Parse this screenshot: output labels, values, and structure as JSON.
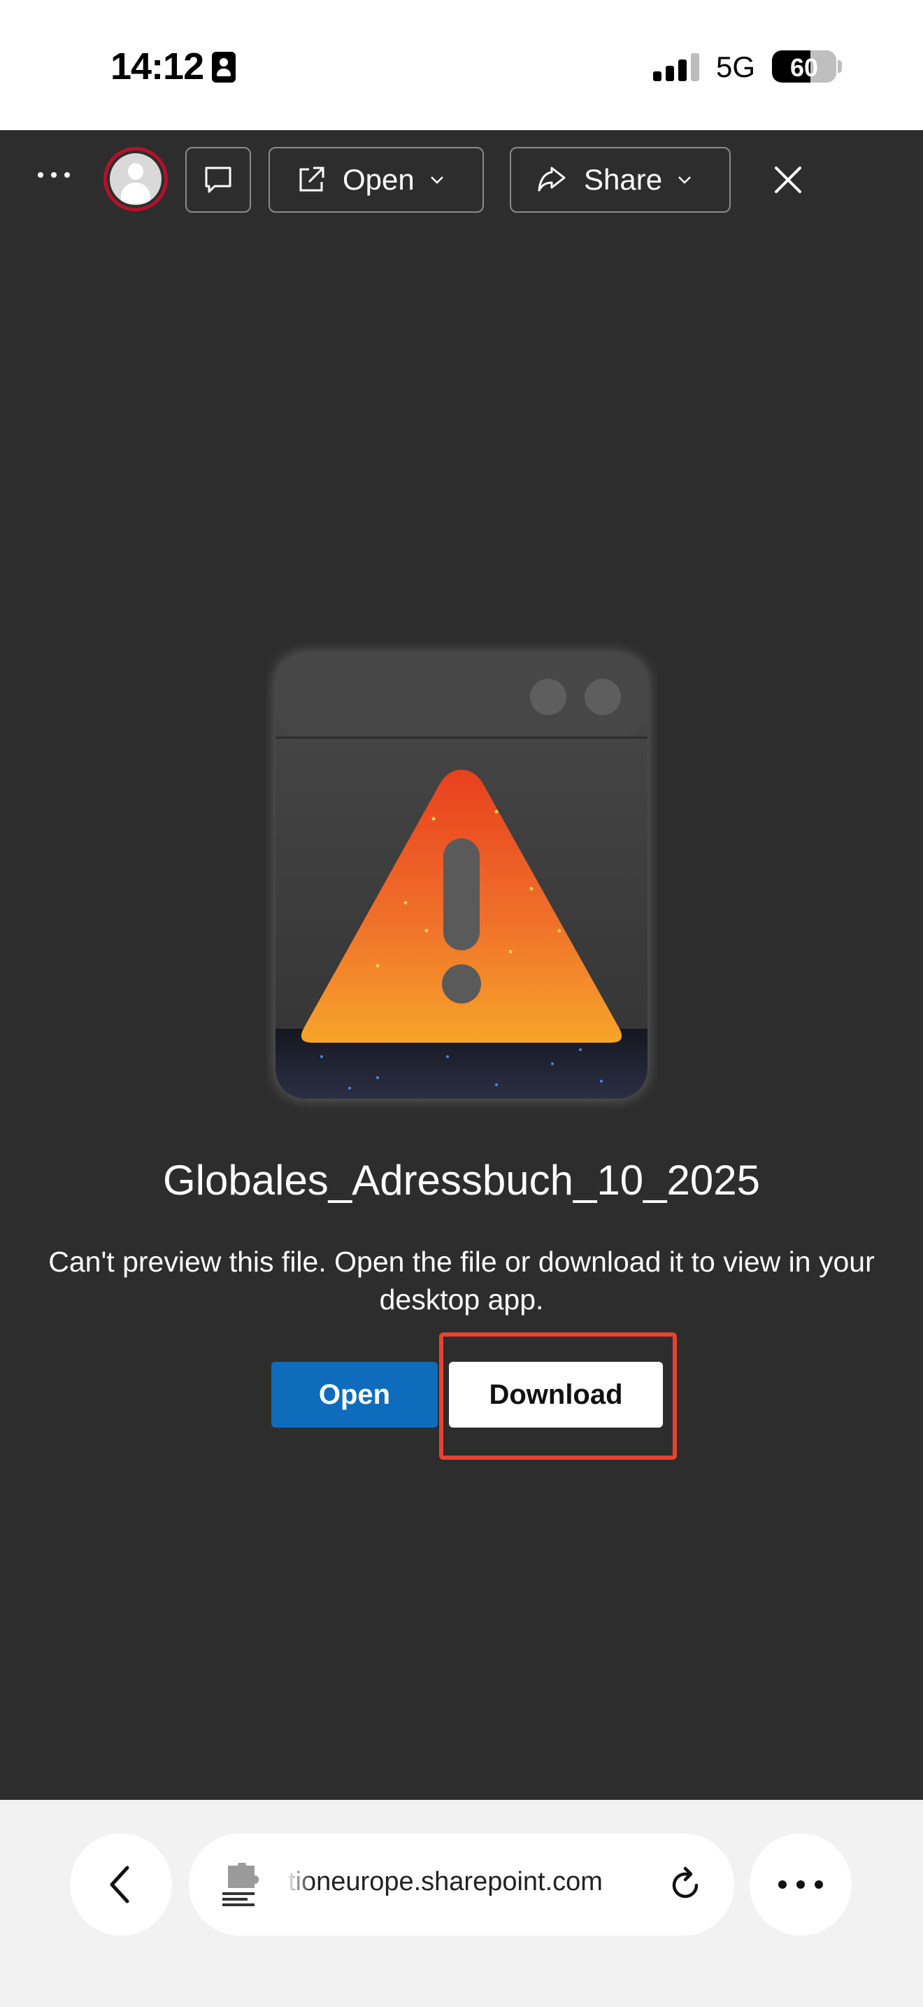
{
  "status_bar": {
    "time": "14:12",
    "network": "5G",
    "battery": "60",
    "battery_level": 0.6,
    "icons": [
      "contact-card-icon",
      "signal-icon",
      "battery-icon"
    ]
  },
  "toolbar": {
    "open_label": "Open",
    "share_label": "Share",
    "icons": [
      "more-icon",
      "avatar",
      "comment-icon",
      "open-external-icon",
      "share-icon",
      "chevron-down-icon",
      "close-icon"
    ]
  },
  "file": {
    "title": "Globales_Adressbuch_10_2025",
    "message": "Can't preview this file. Open the file or download it to view in your desktop app."
  },
  "actions": {
    "open_label": "Open",
    "download_label": "Download"
  },
  "browser": {
    "url": "tioneurope.sharepoint.com",
    "icons": [
      "back-icon",
      "site-extension-icon",
      "reload-icon",
      "more-icon"
    ]
  },
  "colors": {
    "background": "#2d2d2d",
    "primary_button": "#0f6cbd",
    "highlight": "#e8432c",
    "avatar_ring": "#b3122a"
  }
}
